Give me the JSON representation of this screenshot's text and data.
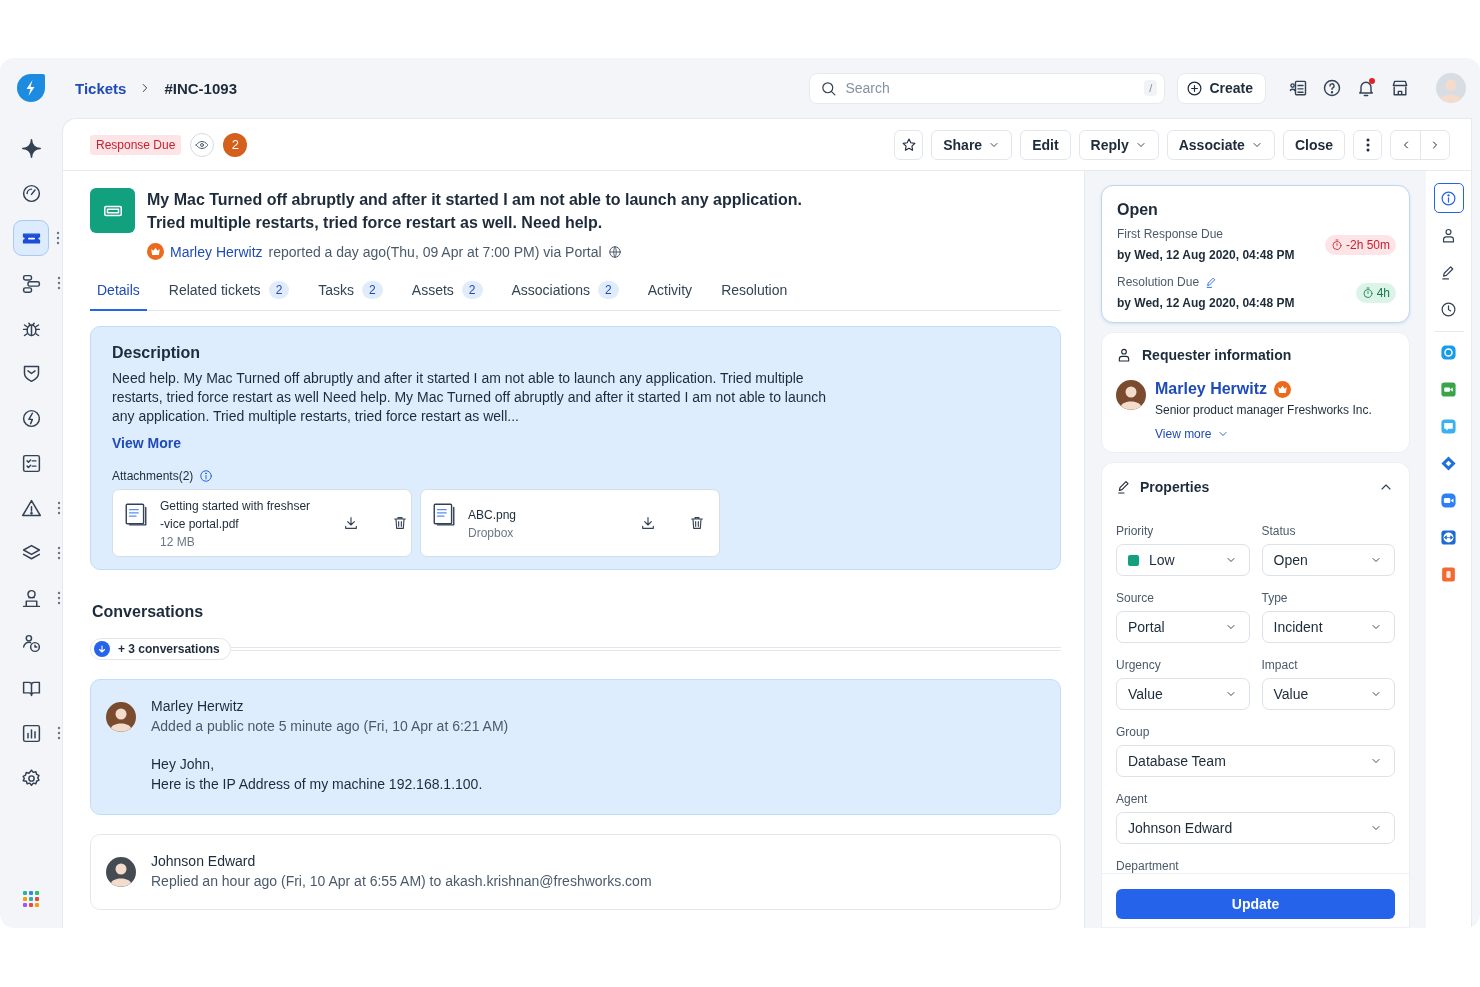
{
  "sidebar": {
    "items": [
      {
        "kind": "sparkle",
        "selected": false,
        "has_menu": false
      },
      {
        "kind": "gauge",
        "selected": false,
        "has_menu": false
      },
      {
        "kind": "ticket",
        "selected": true,
        "has_menu": true
      },
      {
        "kind": "flow",
        "selected": false,
        "has_menu": true
      },
      {
        "kind": "bug",
        "selected": false,
        "has_menu": false
      },
      {
        "kind": "shield",
        "selected": false,
        "has_menu": false
      },
      {
        "kind": "bolt",
        "selected": false,
        "has_menu": false
      },
      {
        "kind": "checklist",
        "selected": false,
        "has_menu": false
      },
      {
        "kind": "warning",
        "selected": false,
        "has_menu": true
      },
      {
        "kind": "layers",
        "selected": false,
        "has_menu": true
      },
      {
        "kind": "desk",
        "selected": false,
        "has_menu": true
      },
      {
        "kind": "userclock",
        "selected": false,
        "has_menu": false
      },
      {
        "kind": "book",
        "selected": false,
        "has_menu": false
      },
      {
        "kind": "chart",
        "selected": false,
        "has_menu": true
      },
      {
        "kind": "gear",
        "selected": false,
        "has_menu": false
      }
    ]
  },
  "topbar": {
    "breadcrumb": [
      {
        "label": "Tickets",
        "kind": "link"
      },
      {
        "label": "#INC-1093",
        "kind": "current"
      }
    ],
    "search": {
      "placeholder": "Search",
      "shortcut": "/"
    },
    "create_button": "Create",
    "icons": [
      {
        "kind": "contacts",
        "dot": false
      },
      {
        "kind": "help",
        "dot": false
      },
      {
        "kind": "bell",
        "dot": true
      },
      {
        "kind": "store",
        "dot": false
      }
    ]
  },
  "ticket_header": {
    "tag": "Response Due",
    "watchers_count": "2",
    "actions": [
      {
        "label": "Share",
        "dropdown": true
      },
      {
        "label": "Edit",
        "dropdown": false
      },
      {
        "label": "Reply",
        "dropdown": true
      },
      {
        "label": "Associate",
        "dropdown": true
      },
      {
        "label": "Close",
        "dropdown": false
      }
    ]
  },
  "ticket": {
    "title_lines": [
      "My Mac Turned off abruptly and after it started I am not able to launch any application.",
      "Tried multiple restarts, tried force restart as well. Need help."
    ],
    "requester": "Marley Herwitz",
    "reported": "reported a day ago(Thu, 09 Apr at 7:00 PM) via Portal"
  },
  "tabs": [
    {
      "label": "Details",
      "selected": true
    },
    {
      "label": "Related tickets",
      "count": "2",
      "selected": false
    },
    {
      "label": "Tasks",
      "count": "2",
      "selected": false
    },
    {
      "label": "Assets",
      "count": "2",
      "selected": false
    },
    {
      "label": "Associations",
      "count": "2",
      "selected": false
    },
    {
      "label": "Activity",
      "selected": false
    },
    {
      "label": "Resolution",
      "selected": false
    }
  ],
  "description": {
    "title": "Description",
    "text": "Need help. My Mac Turned off abruptly and after it started I am not able to launch any application. Tried multiple restarts, tried force restart as well Need help. My Mac Turned off abruptly and after it started I am not able to launch any application. Tried multiple restarts, tried force restart as well...",
    "view_more": "View More",
    "attachments_title": "Attachments(2)",
    "attachments": [
      {
        "name_lines": [
          "Getting started with freshser",
          "-vice portal.pdf"
        ],
        "detail": "12 MB"
      },
      {
        "name_lines": [
          "ABC.png"
        ],
        "detail": "Dropbox"
      }
    ]
  },
  "conversations": {
    "title": "Conversations",
    "more": "+ 3 conversations",
    "items": [
      {
        "kind": "note",
        "author": "Marley Herwitz",
        "meta": "Added a public note 5 minute ago (Fri, 10 Apr at 6:21 AM)",
        "body": [
          "Hey John,",
          "Here is the IP Address of my machine 192.168.1.100."
        ]
      },
      {
        "kind": "reply",
        "author": "Johnson Edward",
        "meta": "Replied an hour ago (Fri, 10 Apr at 6:55 AM) to akash.krishnan@freshworks.com"
      }
    ]
  },
  "sla": {
    "status": "Open",
    "items": [
      {
        "label": "First Response Due",
        "due": "by Wed, 12 Aug 2020, 04:48 PM",
        "timer": "-2h 50m",
        "overdue": true,
        "editable": false
      },
      {
        "label": "Resolution Due",
        "due": "by Wed, 12 Aug 2020, 04:48 PM",
        "timer": "4h",
        "overdue": false,
        "editable": true
      }
    ]
  },
  "requester_info": {
    "title": "Requester information",
    "name": "Marley Herwitz",
    "role": "Senior product manager Freshworks Inc.",
    "view_more": "View more"
  },
  "properties": {
    "title": "Properties",
    "expanded": true,
    "fields": [
      {
        "label": "Priority",
        "value": "Low",
        "kind": "half",
        "color": "#12a17f"
      },
      {
        "label": "Status",
        "value": "Open",
        "kind": "half"
      },
      {
        "label": "Source",
        "value": "Portal",
        "kind": "half"
      },
      {
        "label": "Type",
        "value": "Incident",
        "kind": "half"
      },
      {
        "label": "Urgency",
        "value": "Value",
        "kind": "half"
      },
      {
        "label": "Impact",
        "value": "Value",
        "kind": "half"
      },
      {
        "label": "Group",
        "value": "Database Team",
        "kind": "full"
      },
      {
        "label": "Agent",
        "value": "Johnson Edward",
        "kind": "full"
      },
      {
        "label": "Department",
        "kind": "label"
      }
    ],
    "update_button": "Update"
  },
  "right_rail": [
    {
      "kind": "info",
      "selected": true
    },
    {
      "kind": "person",
      "selected": false
    },
    {
      "kind": "pencil",
      "selected": false
    },
    {
      "kind": "clock",
      "selected": false
    },
    {
      "kind": "skype",
      "color": "#1a9be8"
    },
    {
      "kind": "video",
      "color": "#3aa44a"
    },
    {
      "kind": "chat",
      "color": "#38b2ef"
    },
    {
      "kind": "diamond",
      "color": "#1f6fe0"
    },
    {
      "kind": "zoom",
      "color": "#2d7ff5"
    },
    {
      "kind": "teamviewer",
      "color": "#1a6bd6"
    },
    {
      "kind": "square",
      "color": "#f26a32"
    }
  ]
}
